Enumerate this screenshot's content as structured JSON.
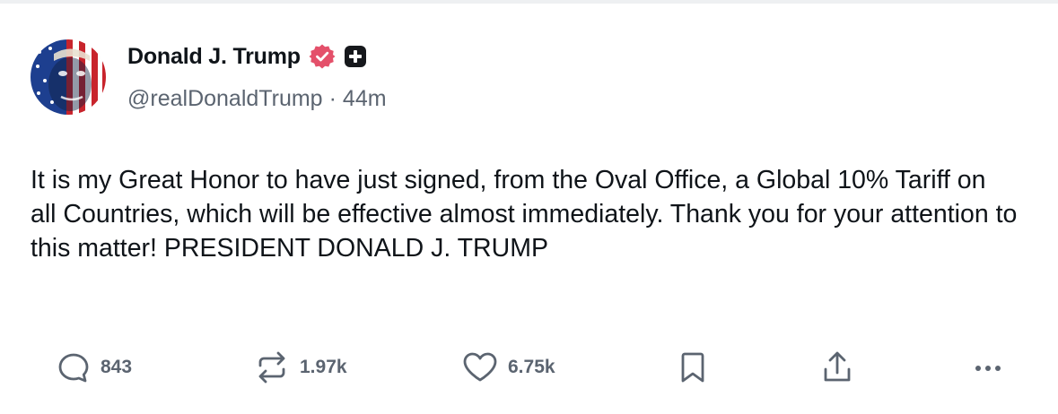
{
  "post": {
    "author": {
      "display_name": "Donald J. Trump",
      "handle": "@realDonaldTrump",
      "separator": "·",
      "time": "44m",
      "avatar_icon": "avatar-flag-portrait",
      "verified_color": "#e4506a"
    },
    "text": "It is my Great Honor to have just signed, from the Oval Office, a Global 10% Tariff on all Countries, which will be effective almost immediately. Thank you for your attention to this matter! PRESIDENT DONALD J. TRUMP",
    "actions": {
      "replies": {
        "icon": "reply-icon",
        "count": "843"
      },
      "retruths": {
        "icon": "retruth-icon",
        "count": "1.97k"
      },
      "likes": {
        "icon": "heart-icon",
        "count": "6.75k"
      },
      "bookmark": {
        "icon": "bookmark-icon"
      },
      "share": {
        "icon": "share-icon"
      },
      "more": {
        "icon": "more-icon"
      }
    }
  }
}
